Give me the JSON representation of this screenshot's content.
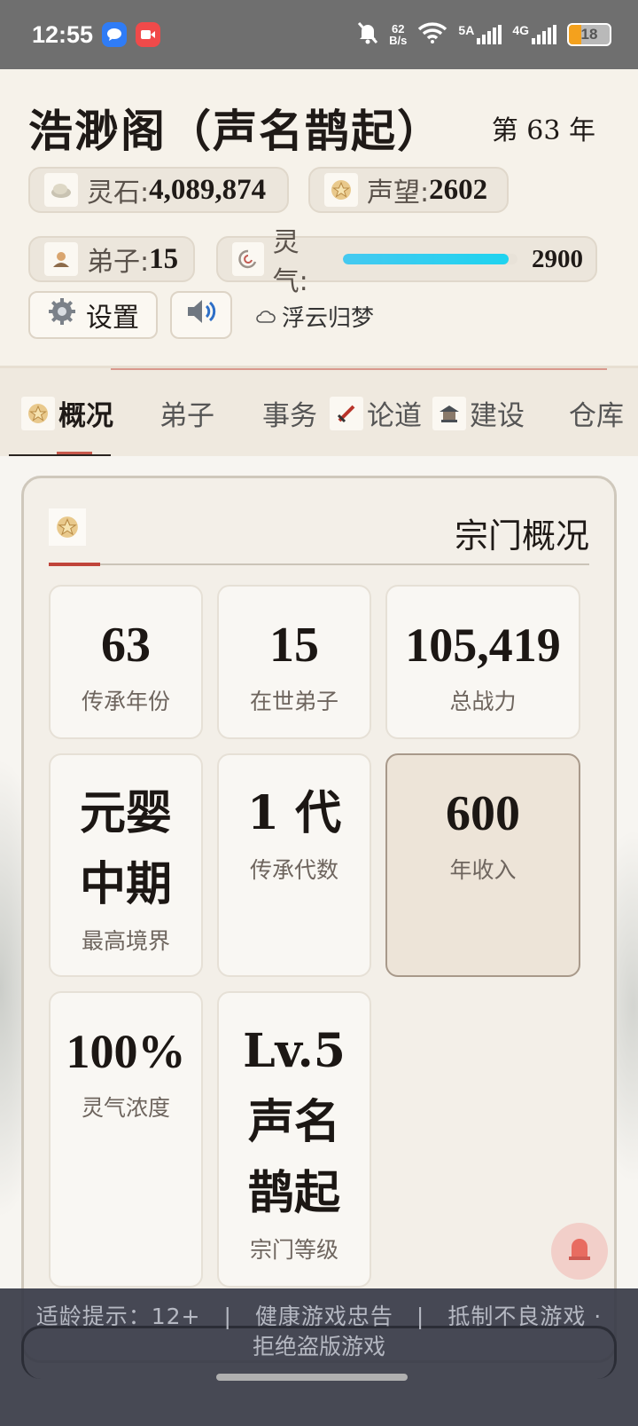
{
  "status_bar": {
    "time": "12:55",
    "net_speed_top": "62",
    "net_speed_bottom": "B/s",
    "sig1_label": "5A",
    "sig2_label": "4G",
    "battery": "18"
  },
  "header": {
    "title": "浩渺阁（声名鹊起）",
    "year": "第 63 年",
    "lingshi_label": "灵石: ",
    "lingshi_value": "4,089,874",
    "shengwang_label": "声望: ",
    "shengwang_value": "2602",
    "dizi_label": "弟子: ",
    "dizi_value": "15",
    "lingqi_label": "灵气:",
    "lingqi_value": "2900",
    "lingqi_fill": 0.95,
    "settings_label": "设置",
    "sect_tag": "浮云归梦"
  },
  "tabs": [
    {
      "label": "概况"
    },
    {
      "label": "弟子"
    },
    {
      "label": "事务"
    },
    {
      "label": "论道"
    },
    {
      "label": "建设"
    },
    {
      "label": "仓库"
    }
  ],
  "overview": {
    "title": "宗门概况",
    "cards": [
      {
        "value": "63",
        "label": "传承年份"
      },
      {
        "value": "15",
        "label": "在世弟子"
      },
      {
        "value": "105,419",
        "label": "总战力"
      },
      {
        "value": "元婴\n中期",
        "label": "最高境界"
      },
      {
        "value": "1 代",
        "label": "传承代数"
      },
      {
        "value": "600",
        "label": "年收入"
      },
      {
        "value": "100%",
        "label": "灵气浓度"
      },
      {
        "value": "Lv.5\n声名\n鹊起",
        "label": "宗门等级"
      }
    ]
  },
  "footer": {
    "line1": "适龄提示：12+　|　健康游戏忠告　|　抵制不良游戏 ·",
    "line2": "拒绝盗版游戏"
  }
}
